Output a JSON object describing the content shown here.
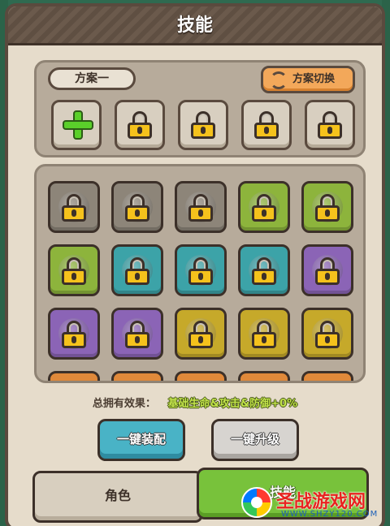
{
  "header": {
    "title": "技能"
  },
  "loadout": {
    "plan_label": "方案一",
    "switch_label": "方案切换",
    "slots": [
      {
        "state": "add",
        "icon": "plus-icon"
      },
      {
        "state": "locked",
        "icon": "lock-icon"
      },
      {
        "state": "locked",
        "icon": "lock-icon"
      },
      {
        "state": "locked",
        "icon": "lock-icon"
      },
      {
        "state": "locked",
        "icon": "lock-icon"
      }
    ]
  },
  "skills": {
    "rows": [
      [
        {
          "rarity": "gray",
          "color": "#8d8579",
          "locked": true
        },
        {
          "rarity": "gray",
          "color": "#8d8579",
          "locked": true
        },
        {
          "rarity": "gray",
          "color": "#8d8579",
          "locked": true
        },
        {
          "rarity": "green",
          "color": "#8db43c",
          "locked": true
        },
        {
          "rarity": "green",
          "color": "#8db43c",
          "locked": true
        }
      ],
      [
        {
          "rarity": "green",
          "color": "#8db43c",
          "locked": true
        },
        {
          "rarity": "teal",
          "color": "#3ca3a8",
          "locked": true
        },
        {
          "rarity": "teal",
          "color": "#3ca3a8",
          "locked": true
        },
        {
          "rarity": "teal",
          "color": "#3ca3a8",
          "locked": true
        },
        {
          "rarity": "purple",
          "color": "#8b64b6",
          "locked": true
        }
      ],
      [
        {
          "rarity": "purple",
          "color": "#8b64b6",
          "locked": true
        },
        {
          "rarity": "purple",
          "color": "#8b64b6",
          "locked": true
        },
        {
          "rarity": "gold",
          "color": "#c6a92a",
          "locked": true
        },
        {
          "rarity": "gold",
          "color": "#c6a92a",
          "locked": true
        },
        {
          "rarity": "gold",
          "color": "#c6a92a",
          "locked": true
        }
      ],
      [
        {
          "rarity": "orange",
          "color": "#e0893a",
          "locked": true
        },
        {
          "rarity": "orange",
          "color": "#e0893a",
          "locked": true
        },
        {
          "rarity": "orange",
          "color": "#e0893a",
          "locked": true
        },
        {
          "rarity": "orange",
          "color": "#e0893a",
          "locked": true
        },
        {
          "rarity": "orange",
          "color": "#e0893a",
          "locked": true
        }
      ]
    ]
  },
  "effect": {
    "label": "总拥有效果：",
    "value": "基础生命&攻击&防御+0%"
  },
  "actions": {
    "equip_label": "一键装配",
    "upgrade_label": "一键升级"
  },
  "tabs": {
    "role_label": "角色",
    "skill_label": "技能"
  },
  "watermark": {
    "text": "圣战游戏网",
    "url": "WWW.SHZY120.COM"
  },
  "colors": {
    "background": "#2f6a50",
    "panel": "#e6dccb",
    "accent_orange": "#f3a85a",
    "accent_teal": "#49b3c6",
    "accent_green": "#78c23b"
  }
}
